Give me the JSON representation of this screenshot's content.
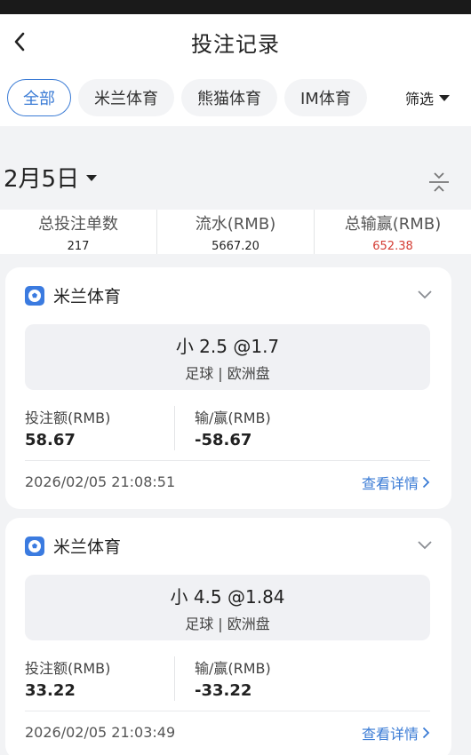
{
  "header": {
    "title": "投注记录"
  },
  "tabs": [
    {
      "label": "全部",
      "active": true
    },
    {
      "label": "米兰体育",
      "active": false
    },
    {
      "label": "熊猫体育",
      "active": false
    },
    {
      "label": "IM体育",
      "active": false
    }
  ],
  "filter": {
    "label": "筛选"
  },
  "date": {
    "label": "2月5日"
  },
  "summary": {
    "count_label": "总投注单数",
    "count_value": "217",
    "flow_label": "流水(RMB)",
    "flow_value": "5667.20",
    "winloss_label": "总输赢(RMB)",
    "winloss_value": "652.38"
  },
  "bets": [
    {
      "vendor": "米兰体育",
      "selection": "小 2.5 @1.7",
      "market": "足球 | 欧洲盘",
      "stake_label": "投注额(RMB)",
      "stake": "58.67",
      "winloss_label": "输/赢(RMB)",
      "winloss": "-58.67",
      "time": "2026/02/05 21:08:51",
      "detail_label": "查看详情"
    },
    {
      "vendor": "米兰体育",
      "selection": "小 4.5 @1.84",
      "market": "足球 | 欧洲盘",
      "stake_label": "投注额(RMB)",
      "stake": "33.22",
      "winloss_label": "输/赢(RMB)",
      "winloss": "-33.22",
      "time": "2026/02/05 21:03:49",
      "detail_label": "查看详情"
    }
  ],
  "colors": {
    "accent": "#3a7bd5",
    "negative": "#d43c33"
  },
  "icons": [
    "back-arrow-icon",
    "caret-down-icon",
    "collapse-icon",
    "soccer-ball-icon",
    "chevron-down-icon",
    "chevron-right-icon"
  ]
}
